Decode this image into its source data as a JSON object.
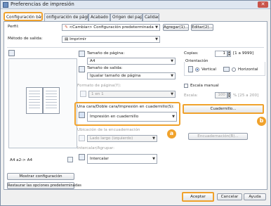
{
  "window": {
    "title": "Preferencias de impresión"
  },
  "tabs": [
    {
      "label": "Configuración básica"
    },
    {
      "label": "onfiguración de página"
    },
    {
      "label": "Acabado"
    },
    {
      "label": "Origen del papel"
    },
    {
      "label": "Calidad"
    }
  ],
  "header": {
    "profile_label": "Perfil:",
    "profile_value": "<Cambiar> Configuración predeterminada",
    "add_button": "Agregar(1)...",
    "edit_button": "Editar(2)...",
    "output_label": "Método de salida:",
    "output_value": "Imprimir"
  },
  "preview": {
    "caption": "A4 a2-> A4"
  },
  "left_buttons": {
    "show_settings": "Mostrar configuración",
    "restore_defaults": "Restaurar las opciones predeterminadas"
  },
  "page_size": {
    "label": "Tamaño de página:",
    "value": "A4"
  },
  "output_size": {
    "label": "Tamaño de salida:",
    "value": "Igualar tamaño de página"
  },
  "page_layout": {
    "label": "Formato de página(Y):",
    "value": "1 en 1"
  },
  "duplex": {
    "label": "Una cara/Doble cara/Impresión en cuadernillo(S):",
    "value": "Impresión en cuadernillo"
  },
  "binding": {
    "label": "Ubicación de la encuadernación",
    "value": "Lado largo (izquierdo)",
    "button": "Encuadernación(B)..."
  },
  "collate": {
    "label": "Intercalar/Agrupar:",
    "value": "Intercalar"
  },
  "copies": {
    "label": "Copias:",
    "value": "1",
    "range": "[1 a 9999]"
  },
  "orientation": {
    "label": "Orientación",
    "vertical": "Vertical",
    "horizontal": "Horizontal",
    "selected": "Vertical"
  },
  "manual_scaling": {
    "label": "Escala manual",
    "scale_label": "Escala:",
    "scale_value": "100",
    "scale_range": "% [25 a 200]"
  },
  "booklet_button": "Cuadernillo...",
  "badges": {
    "a": "a",
    "b": "b"
  },
  "footer": {
    "ok": "Aceptar",
    "cancel": "Cancelar",
    "help": "Ayuda"
  }
}
